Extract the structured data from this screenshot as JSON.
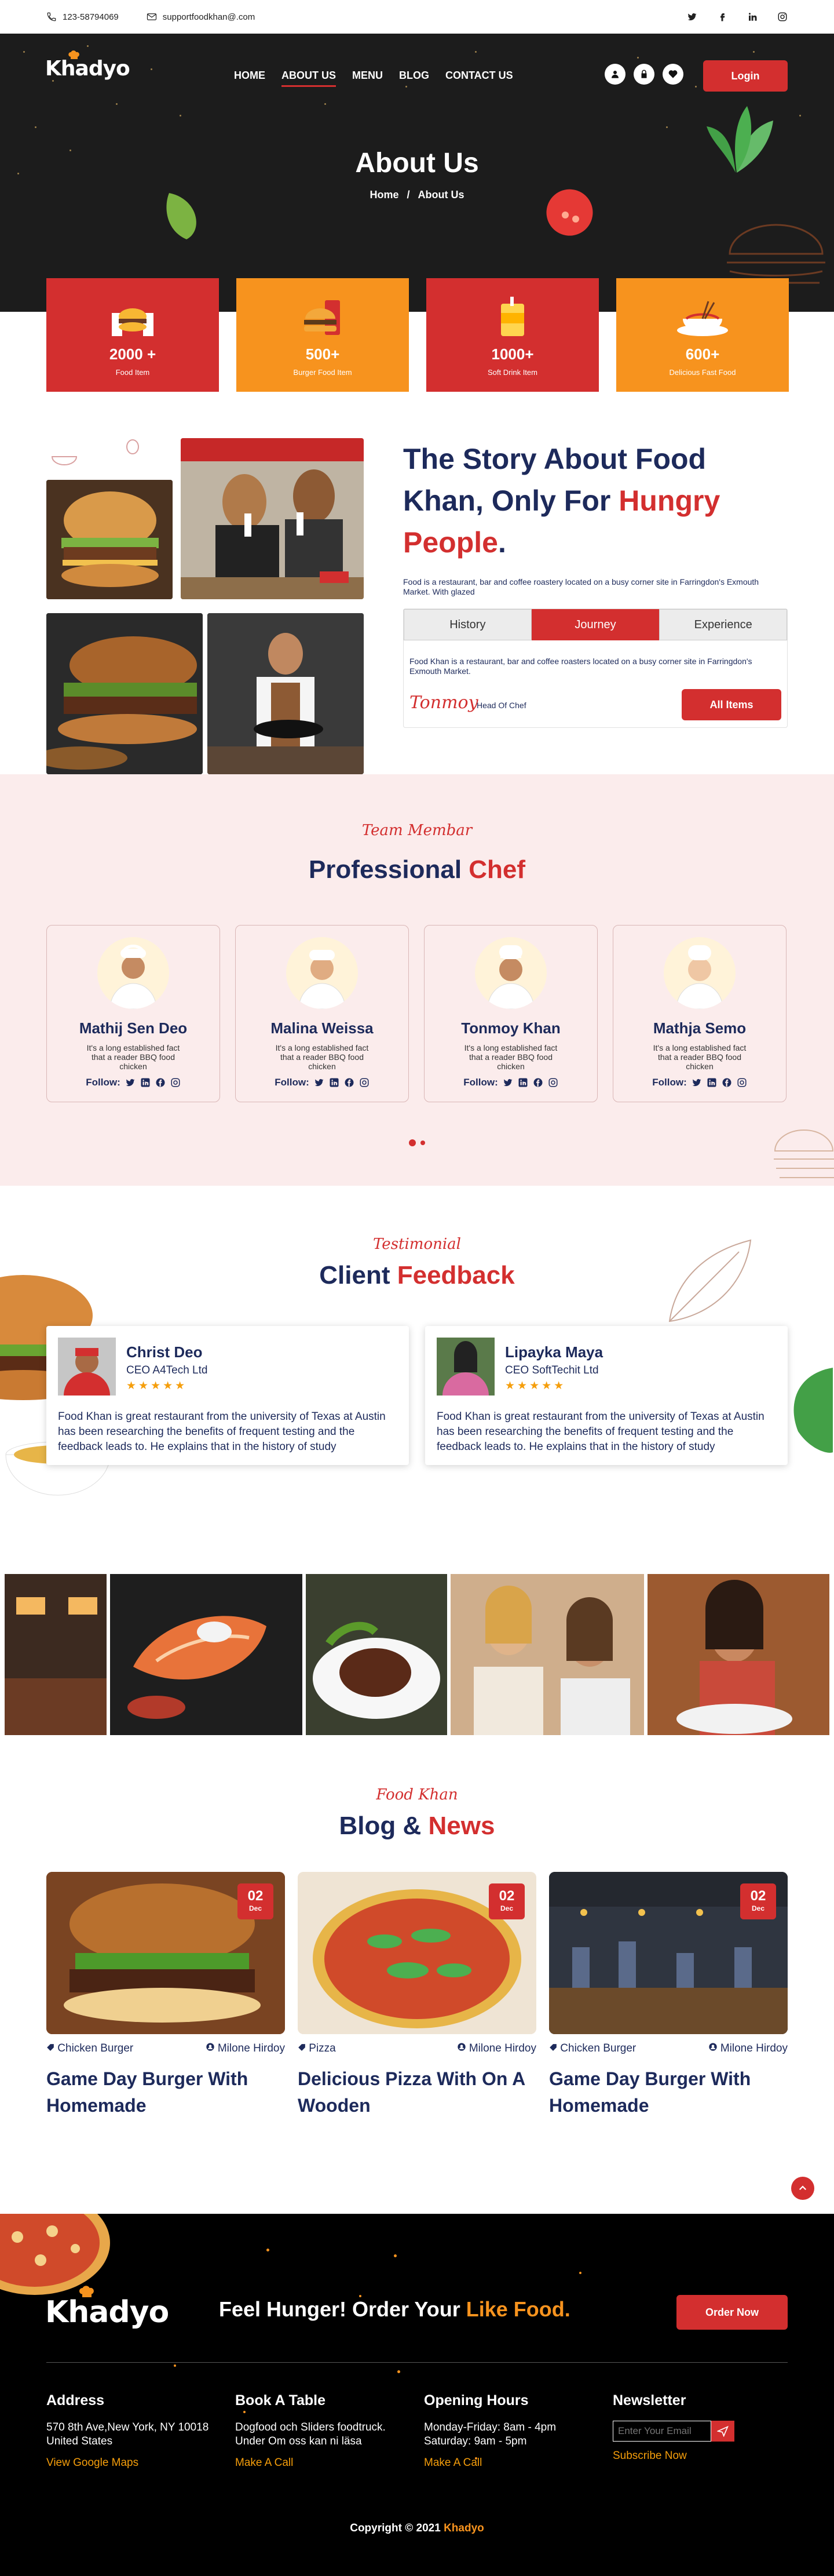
{
  "topbar": {
    "phone": "123-58794069",
    "email": "supportfoodkhan@.com",
    "social": [
      "twitter-icon",
      "facebook-icon",
      "linkedin-icon",
      "instagram-icon"
    ]
  },
  "brand": {
    "name": "Khadyo"
  },
  "nav": {
    "items": [
      "HOME",
      "ABOUT US",
      "MENU",
      "BLOG",
      "CONTACT US"
    ],
    "active": "ABOUT US",
    "login": "Login"
  },
  "hero": {
    "title": "About Us",
    "breadcrumb_home": "Home",
    "breadcrumb_sep": "/",
    "breadcrumb_current": "About Us"
  },
  "stats": [
    {
      "value": "2000 +",
      "label": "Food Item",
      "color": "#d32f2f"
    },
    {
      "value": "500+",
      "label": "Burger Food Item",
      "color": "#f7931e"
    },
    {
      "value": "1000+",
      "label": "Soft Drink Item",
      "color": "#d32f2f"
    },
    {
      "value": "600+",
      "label": "Delicious Fast Food",
      "color": "#f7931e"
    }
  ],
  "story": {
    "title_line1": "The Story About Food",
    "title_line2a": "Khan, Only For ",
    "title_line2b": "Hungry",
    "title_line3a": "People",
    "title_line3b": ".",
    "paragraph": "Food is a restaurant, bar and coffee roastery located on a busy corner site in Farringdon's Exmouth Market. With glazed",
    "tabs": [
      "History",
      "Journey",
      "Experience"
    ],
    "active_tab": "Journey",
    "tab_text": "Food Khan is a restaurant, bar and coffee roasters located on a busy corner site in Farringdon's Exmouth Market.",
    "signature": "Tonmoy",
    "signature_role": "Head Of Chef",
    "all_items": "All Items"
  },
  "team": {
    "kicker": "Team Membar",
    "title_a": "Professional ",
    "title_b": "Chef",
    "follow": "Follow:",
    "chefs": [
      {
        "name": "Mathij Sen Deo",
        "desc": "It's a  long established fact that a reader BBQ food chicken"
      },
      {
        "name": "Malina Weissa",
        "desc": "It's a  long established fact that a reader BBQ food chicken"
      },
      {
        "name": "Tonmoy Khan",
        "desc": "It's a  long established fact that a reader BBQ food chicken"
      },
      {
        "name": "Mathja Semo",
        "desc": "It's a  long established fact that a reader BBQ food chicken"
      }
    ]
  },
  "testimonial": {
    "kicker": "Testimonial",
    "title_a": "Client ",
    "title_b": "Feedback",
    "stars": "★★★★★",
    "items": [
      {
        "name": "Christ Deo",
        "role": "CEO A4Tech Ltd",
        "text": "Food Khan is great restaurant from  the university of Texas at Austin has been researching the benefits of frequent testing and the feedback leads to. He explains that in the history of study"
      },
      {
        "name": "Lipayka Maya",
        "role": "CEO SoftTechit Ltd",
        "text": "Food Khan is great restaurant from  the university of Texas at Austin has been researching the benefits of frequent testing and the feedback leads to. He explains that in the history of study"
      }
    ]
  },
  "blog": {
    "kicker": "Food Khan",
    "title_a": "Blog ",
    "title_amp": "& ",
    "title_b": "News",
    "posts": [
      {
        "day": "02",
        "month": "Dec",
        "category": "Chicken Burger",
        "author": "Milone Hirdoy",
        "title": "Game Day Burger  With Homemade"
      },
      {
        "day": "02",
        "month": "Dec",
        "category": "Pizza",
        "author": "Milone Hirdoy",
        "title": "Delicious Pizza With On A Wooden"
      },
      {
        "day": "02",
        "month": "Dec",
        "category": "Chicken Burger",
        "author": "Milone Hirdoy",
        "title": "Game Day Burger  With Homemade"
      }
    ]
  },
  "footer": {
    "cta_a": "Feel Hunger! Order Your ",
    "cta_b": "Like Food.",
    "order_now": "Order Now",
    "address": {
      "title": "Address",
      "line1": "570 8th Ave,New York, NY 10018",
      "line2": "United States",
      "link": "View Google Maps"
    },
    "table": {
      "title": "Book A Table",
      "line1": "Dogfood och Sliders foodtruck.",
      "line2": "Under Om oss kan ni läsa",
      "link": "Make A Call"
    },
    "hours": {
      "title": "Opening Hours",
      "line1": "Monday-Friday: 8am - 4pm",
      "line2": "Saturday: 9am - 5pm",
      "link": "Make A Call"
    },
    "newsletter": {
      "title": "Newsletter",
      "placeholder": "Enter Your Email",
      "link": "Subscribe Now"
    },
    "copyright_a": "Copyright © 2021 ",
    "copyright_b": "Khadyo"
  },
  "colors": {
    "red": "#d32f2f",
    "orange": "#f7931e",
    "navy": "#1d2a5b",
    "dark": "#1c1c1c"
  }
}
